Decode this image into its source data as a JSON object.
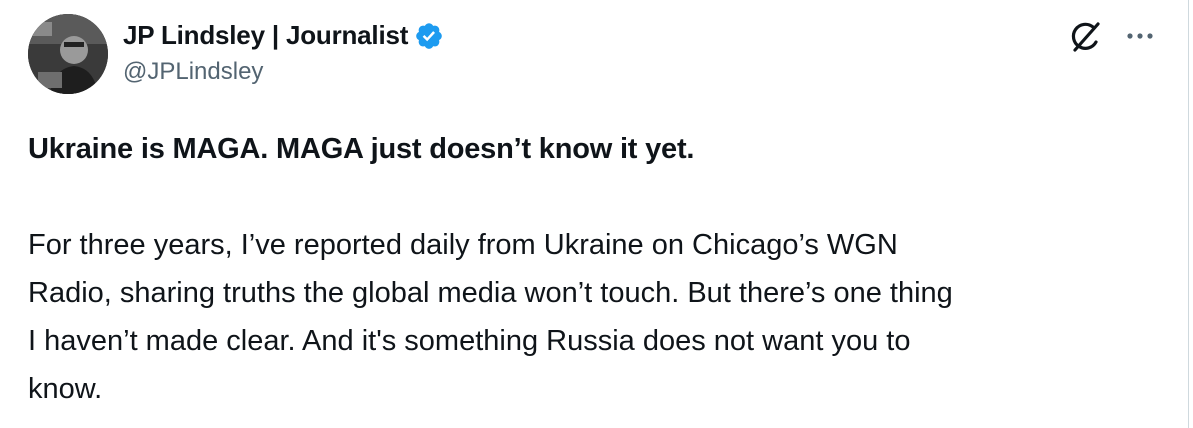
{
  "author": {
    "display_name": "JP Lindsley | Journalist",
    "handle": "@JPLindsley",
    "verified": true,
    "verified_color": "#1d9bf0"
  },
  "actions": {
    "grok_icon": "grok-icon",
    "more_icon": "more-options-icon"
  },
  "tweet": {
    "headline": "Ukraine is MAGA. MAGA just doesn’t know it yet.",
    "body": "For three years, I’ve reported daily from Ukraine on Chicago’s WGN\nRadio, sharing truths the global media won’t touch. But there’s one thing\nI haven’t made clear. And it's something Russia does not want you to\nknow."
  },
  "colors": {
    "text_primary": "#0f1419",
    "text_secondary": "#536471",
    "accent": "#1d9bf0",
    "background": "#ffffff"
  }
}
